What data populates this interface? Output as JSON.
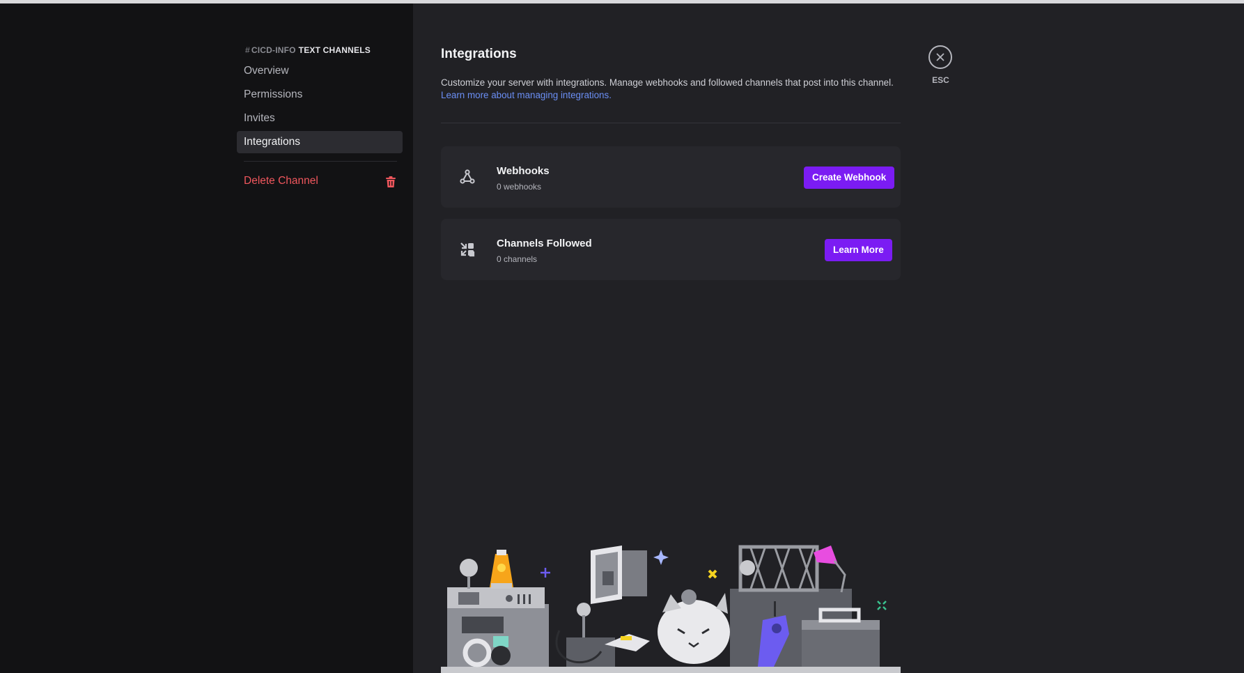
{
  "sidebar": {
    "header": {
      "hash": "#",
      "channel": "CICD-INFO",
      "category": "TEXT CHANNELS"
    },
    "items": [
      {
        "label": "Overview",
        "selected": false
      },
      {
        "label": "Permissions",
        "selected": false
      },
      {
        "label": "Invites",
        "selected": false
      },
      {
        "label": "Integrations",
        "selected": true
      }
    ],
    "delete_label": "Delete Channel"
  },
  "main": {
    "title": "Integrations",
    "description": "Customize your server with integrations. Manage webhooks and followed channels that post into this channel.",
    "learn_link": "Learn more about managing integrations.",
    "cards": [
      {
        "icon": "webhook-icon",
        "title": "Webhooks",
        "subtitle": "0 webhooks",
        "button": "Create Webhook"
      },
      {
        "icon": "channels-followed-icon",
        "title": "Channels Followed",
        "subtitle": "0 channels",
        "button": "Learn More"
      }
    ]
  },
  "close": {
    "label": "ESC",
    "icon": "close-icon"
  },
  "colors": {
    "accent": "#7b1cf3",
    "link": "#6b8ff5",
    "danger": "#f0575d",
    "sidebar_bg": "#121214",
    "content_bg": "#212125"
  }
}
